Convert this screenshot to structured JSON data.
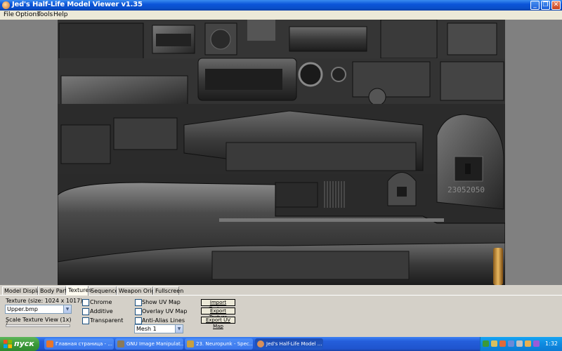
{
  "window": {
    "title": "Jed's Half-Life Model Viewer v1.35",
    "minimize_glyph": "_",
    "maximize_glyph": "❐",
    "close_glyph": "✕"
  },
  "menu": [
    "File",
    "Options",
    "Tools",
    "Help"
  ],
  "viewport": {
    "texture_serial": "23052050"
  },
  "tabs": [
    "Model Display",
    "Body Parts",
    "Textures",
    "Sequences",
    "Weapon Origin",
    "Fullscreen"
  ],
  "active_tab": "Textures",
  "textures_panel": {
    "texture_size_label": "Texture (size: 1024 x 1017)",
    "texture_select_value": "Upper.bmp",
    "scale_label": "Scale Texture View (1x)",
    "scale_value": "?",
    "chrome_label": "Chrome",
    "additive_label": "Additive",
    "transparent_label": "Transparent",
    "show_uv_label": "Show UV Map",
    "overlay_uv_label": "Overlay UV Map",
    "anti_alias_label": "Anti-Alias Lines",
    "mesh_select_value": "Mesh 1",
    "import_btn": "Import Texture",
    "export_btn": "Export Texture",
    "export_uv_btn": "Export UV Map"
  },
  "taskbar": {
    "start_label": "пуск",
    "tasks": [
      "Главная страница - ...",
      "GNU Image Manipulat...",
      "23. Neuropunk - Spec...",
      "Jed's Half-Life Model ..."
    ],
    "clock": "1:32"
  },
  "colors": {
    "titlebar": "#0b55d9",
    "taskbar": "#245edb",
    "start_button": "#3c9a3a",
    "tray": "#0f8ae0"
  }
}
